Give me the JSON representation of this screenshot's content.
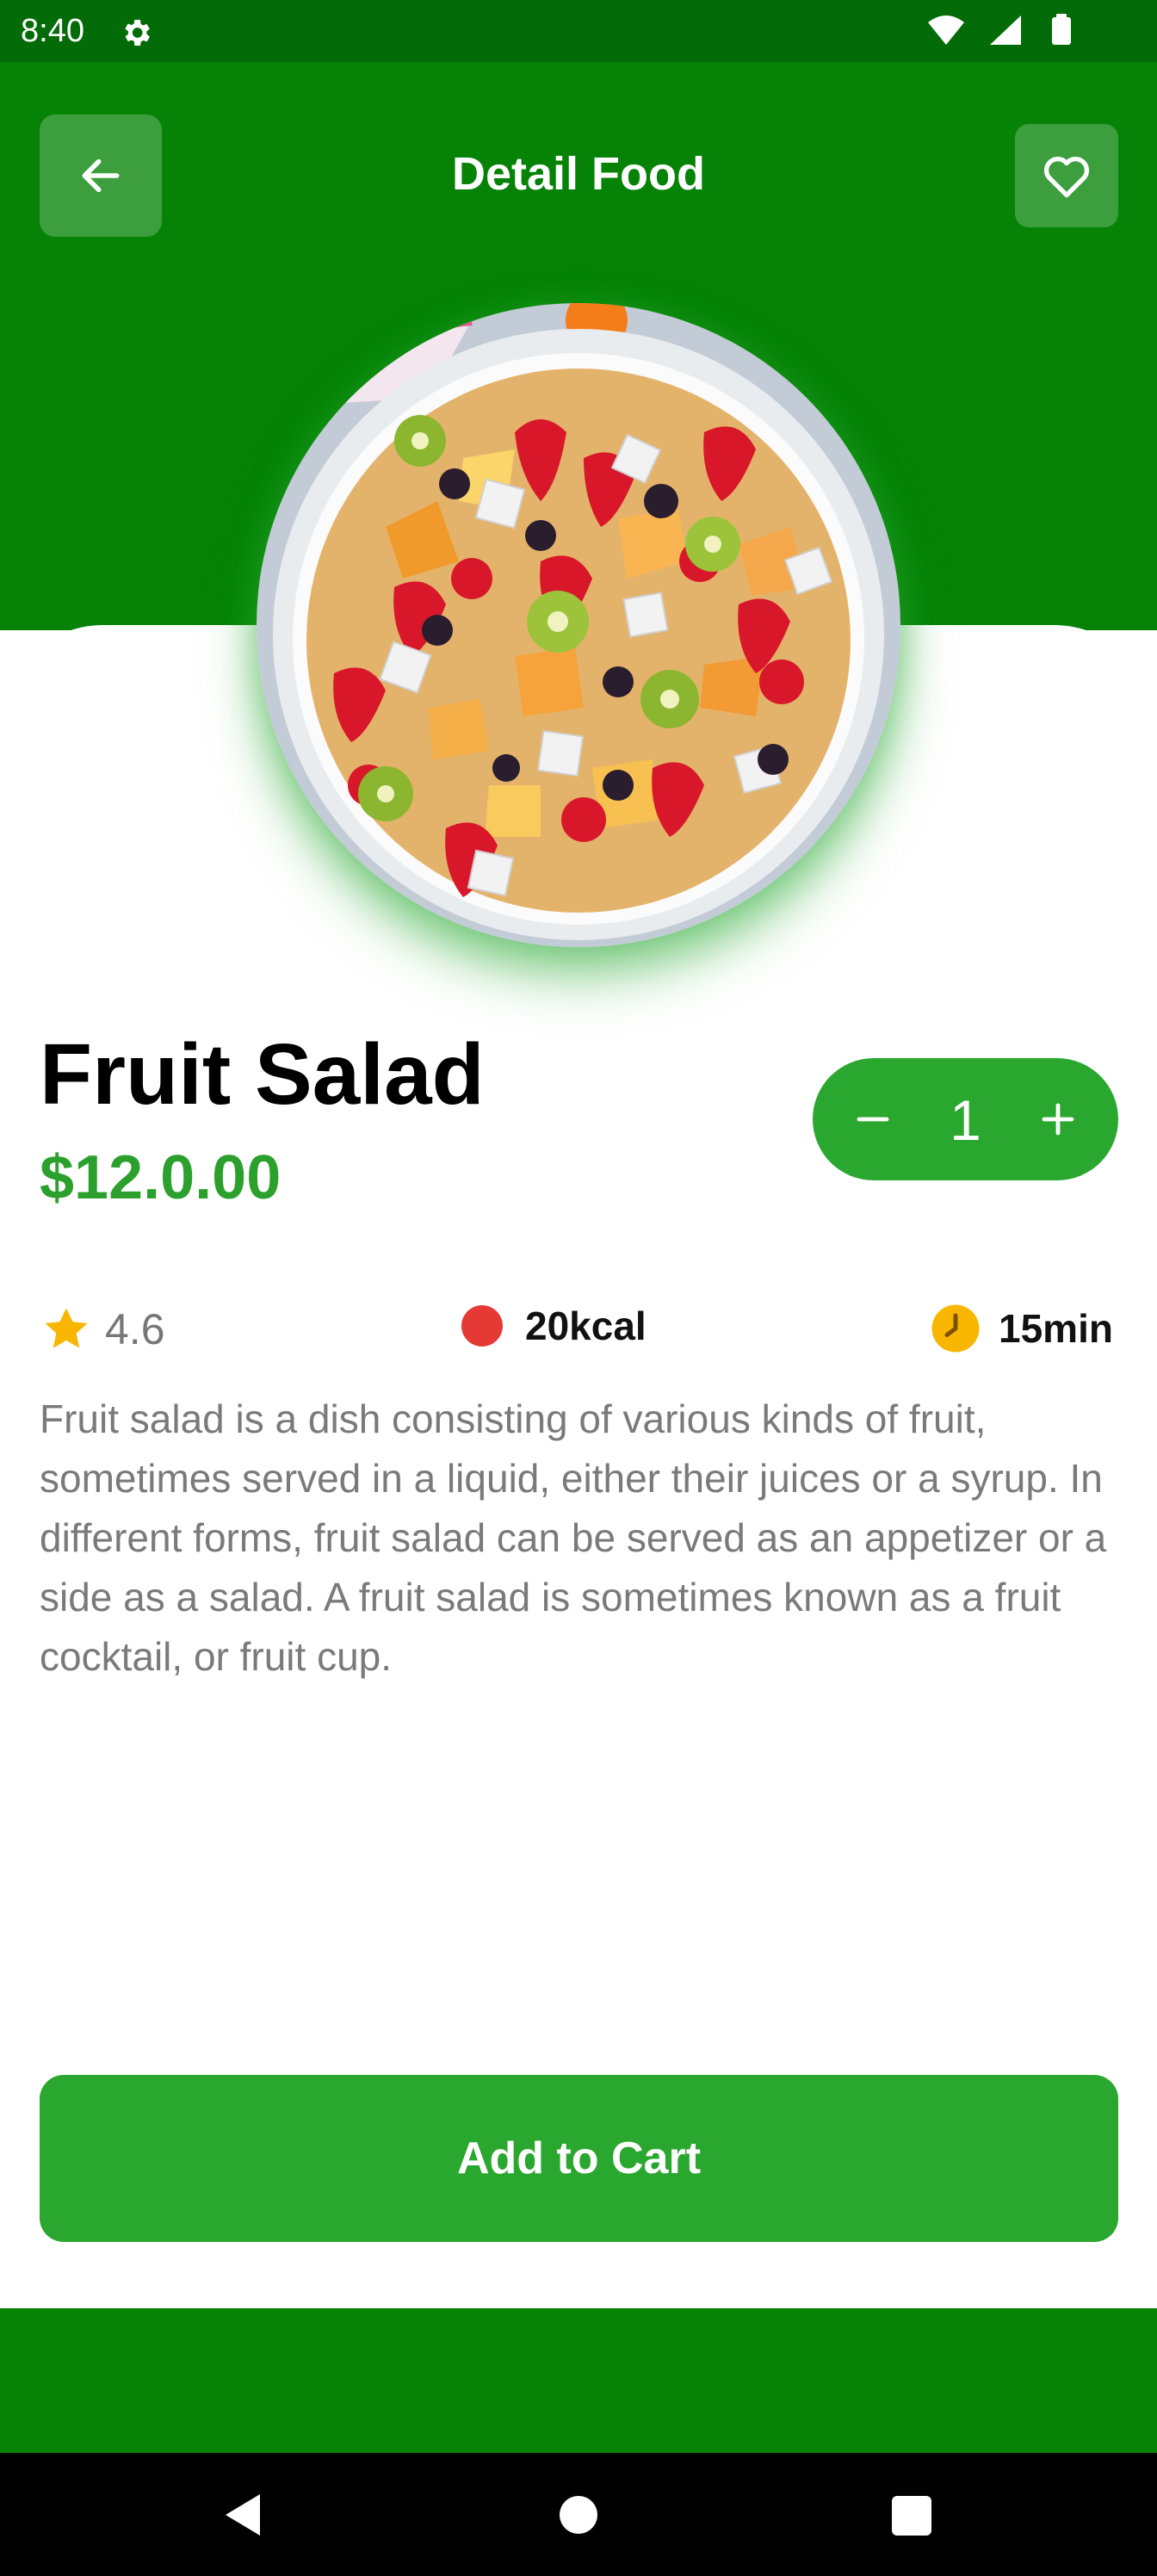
{
  "status_bar": {
    "time": "8:40"
  },
  "header": {
    "title": "Detail Food"
  },
  "food": {
    "name": "Fruit Salad",
    "price": "$12.0.00",
    "quantity": "1",
    "rating": "4.6",
    "calories": "20kcal",
    "time": "15min",
    "description": "Fruit salad is a dish consisting of various kinds of fruit, sometimes served in a liquid, either their juices or a syrup. In different forms, fruit salad can be served as an appetizer or a side as a salad. A fruit salad is sometimes known as a fruit cocktail, or fruit cup."
  },
  "actions": {
    "add_to_cart": "Add to Cart"
  },
  "colors": {
    "primary_green": "#068307",
    "button_green": "#29a72e",
    "price_green": "#2ca02c",
    "kcal_red": "#e53935",
    "time_orange": "#f9b600",
    "star_gold": "#f9b600"
  },
  "icons": {
    "back": "arrow-left-icon",
    "favorite": "heart-outline-icon",
    "minus": "minus-icon",
    "plus": "plus-icon",
    "rating": "star-icon",
    "calories": "red-dot-icon",
    "time": "clock-icon"
  }
}
